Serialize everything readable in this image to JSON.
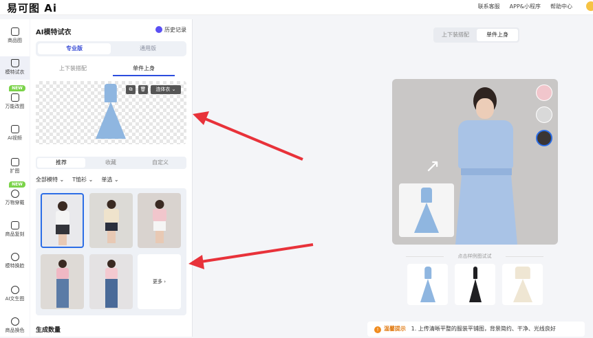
{
  "brand": {
    "logo_text": "易可图 Ai"
  },
  "topbar": {
    "links": [
      "联系客服",
      "APP&小程序",
      "帮助中心"
    ]
  },
  "sidenav": {
    "items": [
      {
        "label": "商品图",
        "badge": ""
      },
      {
        "label": "模特试衣",
        "badge": "",
        "active": true
      },
      {
        "label": "万能改图",
        "badge": "NEW"
      },
      {
        "label": "AI视频",
        "badge": ""
      },
      {
        "label": "扩图",
        "badge": ""
      },
      {
        "label": "万物穿戴",
        "badge": "NEW"
      },
      {
        "label": "商品复刻",
        "badge": ""
      },
      {
        "label": "模特换脸",
        "badge": ""
      },
      {
        "label": "AI文生图",
        "badge": ""
      },
      {
        "label": "商品换色",
        "badge": ""
      }
    ]
  },
  "panel": {
    "title": "AI模特试衣",
    "history": "历史记录",
    "version_tabs": [
      "专业版",
      "通用版"
    ],
    "mode_tabs": [
      "上下装搭配",
      "单件上身"
    ],
    "garment_type": "连体衣",
    "model_tabs": [
      "推荐",
      "收藏",
      "自定义"
    ],
    "filters": [
      "全部模特",
      "T恤衫",
      "单选"
    ],
    "more_label": "更多",
    "gen_count_label": "生成数量"
  },
  "main": {
    "toggle": [
      "上下装搭配",
      "单件上身"
    ],
    "sample_label": "点击样例图试试",
    "tip_title": "温馨提示",
    "tip_text": "1. 上传清晰平整的服装平铺图，背景简约、干净、光线良好"
  },
  "colors": {
    "accent": "#2b4cde",
    "arrow": "#e8323a",
    "new_badge": "#7bd34a",
    "dress_blue": "#8fb6e0"
  },
  "icons": [
    "clock-icon",
    "trash-icon",
    "copy-icon",
    "chevron-down-icon",
    "warning-icon",
    "arrow-icon"
  ]
}
